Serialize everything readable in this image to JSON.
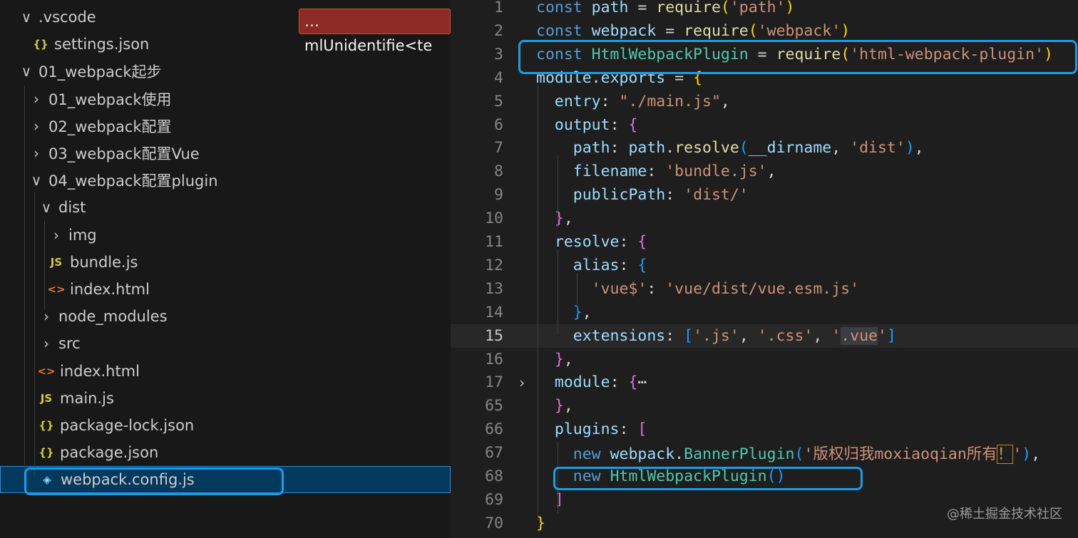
{
  "explorer": {
    "error_badge": "…mlUnidentifie<te",
    "items": [
      {
        "label": ".vscode",
        "chevron": "∨",
        "icon": "",
        "icon_name": "chevron-down-icon"
      },
      {
        "label": "settings.json",
        "chevron": "",
        "icon": "{}",
        "icon_name": "json-file-icon"
      },
      {
        "label": "01_webpack起步",
        "chevron": "∨",
        "icon": "",
        "icon_name": "chevron-down-icon"
      },
      {
        "label": "01_webpack使用",
        "chevron": "›",
        "icon": "",
        "icon_name": "chevron-right-icon"
      },
      {
        "label": "02_webpack配置",
        "chevron": "›",
        "icon": "",
        "icon_name": "chevron-right-icon"
      },
      {
        "label": "03_webpack配置Vue",
        "chevron": "›",
        "icon": "",
        "icon_name": "chevron-right-icon"
      },
      {
        "label": "04_webpack配置plugin",
        "chevron": "∨",
        "icon": "",
        "icon_name": "chevron-down-icon"
      },
      {
        "label": "dist",
        "chevron": "∨",
        "icon": "",
        "icon_name": "chevron-down-icon"
      },
      {
        "label": "img",
        "chevron": "›",
        "icon": "",
        "icon_name": "chevron-right-icon"
      },
      {
        "label": "bundle.js",
        "chevron": "",
        "icon": "JS",
        "icon_name": "js-file-icon"
      },
      {
        "label": "index.html",
        "chevron": "",
        "icon": "<>",
        "icon_name": "html-file-icon"
      },
      {
        "label": "node_modules",
        "chevron": "›",
        "icon": "",
        "icon_name": "chevron-right-icon"
      },
      {
        "label": "src",
        "chevron": "›",
        "icon": "",
        "icon_name": "chevron-right-icon"
      },
      {
        "label": "index.html",
        "chevron": "",
        "icon": "<>",
        "icon_name": "html-file-icon"
      },
      {
        "label": "main.js",
        "chevron": "",
        "icon": "JS",
        "icon_name": "js-file-icon"
      },
      {
        "label": "package-lock.json",
        "chevron": "",
        "icon": "{}",
        "icon_name": "json-file-icon"
      },
      {
        "label": "package.json",
        "chevron": "",
        "icon": "{}",
        "icon_name": "json-file-icon"
      },
      {
        "label": "webpack.config.js",
        "chevron": "",
        "icon": "◈",
        "icon_name": "webpack-file-icon",
        "selected": true
      }
    ]
  },
  "editor": {
    "lines": [
      {
        "n": "1",
        "tokens": [
          [
            "kw",
            "const "
          ],
          [
            "var",
            "path"
          ],
          [
            "pl",
            " = "
          ],
          [
            "fn",
            "require"
          ],
          [
            "p1",
            "("
          ],
          [
            "str",
            "'path'"
          ],
          [
            "p1",
            ")"
          ]
        ]
      },
      {
        "n": "2",
        "tokens": [
          [
            "kw",
            "const "
          ],
          [
            "var",
            "webpack"
          ],
          [
            "pl",
            " = "
          ],
          [
            "fn",
            "require"
          ],
          [
            "p1",
            "("
          ],
          [
            "str",
            "'webpack'"
          ],
          [
            "p1",
            ")"
          ]
        ]
      },
      {
        "n": "3",
        "tokens": [
          [
            "kw",
            "const "
          ],
          [
            "cls",
            "HtmlWebpackPlugin"
          ],
          [
            "pl",
            " = "
          ],
          [
            "fn",
            "require"
          ],
          [
            "p1",
            "("
          ],
          [
            "str",
            "'html-webpack-plugin'"
          ],
          [
            "p1",
            ")"
          ]
        ]
      },
      {
        "n": "4",
        "tokens": [
          [
            "var",
            "module"
          ],
          [
            "pl",
            "."
          ],
          [
            "var",
            "exports"
          ],
          [
            "pl",
            " = "
          ],
          [
            "p1",
            "{"
          ]
        ]
      },
      {
        "n": "5",
        "tokens": [
          [
            "pl",
            "  "
          ],
          [
            "var",
            "entry"
          ],
          [
            "pl",
            ": "
          ],
          [
            "str",
            "\"./main.js\""
          ],
          [
            "pl",
            ","
          ]
        ]
      },
      {
        "n": "6",
        "tokens": [
          [
            "pl",
            "  "
          ],
          [
            "var",
            "output"
          ],
          [
            "pl",
            ": "
          ],
          [
            "p2",
            "{"
          ]
        ]
      },
      {
        "n": "7",
        "tokens": [
          [
            "pl",
            "    "
          ],
          [
            "var",
            "path"
          ],
          [
            "pl",
            ": "
          ],
          [
            "var",
            "path"
          ],
          [
            "pl",
            "."
          ],
          [
            "fn",
            "resolve"
          ],
          [
            "p3",
            "("
          ],
          [
            "var",
            "__dirname"
          ],
          [
            "pl",
            ", "
          ],
          [
            "str",
            "'dist'"
          ],
          [
            "p3",
            ")"
          ],
          [
            "pl",
            ","
          ]
        ]
      },
      {
        "n": "8",
        "tokens": [
          [
            "pl",
            "    "
          ],
          [
            "var",
            "filename"
          ],
          [
            "pl",
            ": "
          ],
          [
            "str",
            "'bundle.js'"
          ],
          [
            "pl",
            ","
          ]
        ]
      },
      {
        "n": "9",
        "tokens": [
          [
            "pl",
            "    "
          ],
          [
            "var",
            "publicPath"
          ],
          [
            "pl",
            ": "
          ],
          [
            "str",
            "'dist/'"
          ]
        ]
      },
      {
        "n": "10",
        "tokens": [
          [
            "pl",
            "  "
          ],
          [
            "p2",
            "}"
          ],
          [
            "pl",
            ","
          ]
        ]
      },
      {
        "n": "11",
        "tokens": [
          [
            "pl",
            "  "
          ],
          [
            "var",
            "resolve"
          ],
          [
            "pl",
            ": "
          ],
          [
            "p2",
            "{"
          ]
        ]
      },
      {
        "n": "12",
        "tokens": [
          [
            "pl",
            "    "
          ],
          [
            "var",
            "alias"
          ],
          [
            "pl",
            ": "
          ],
          [
            "p3",
            "{"
          ]
        ]
      },
      {
        "n": "13",
        "tokens": [
          [
            "pl",
            "      "
          ],
          [
            "str",
            "'vue$'"
          ],
          [
            "pl",
            ": "
          ],
          [
            "str",
            "'vue/dist/vue.esm.js'"
          ]
        ]
      },
      {
        "n": "14",
        "tokens": [
          [
            "pl",
            "    "
          ],
          [
            "p3",
            "}"
          ],
          [
            "pl",
            ","
          ]
        ]
      },
      {
        "n": "15",
        "current": true,
        "tokens": [
          [
            "pl",
            "    "
          ],
          [
            "var",
            "extensions"
          ],
          [
            "pl",
            ": "
          ],
          [
            "p3",
            "["
          ],
          [
            "str",
            "'.js'"
          ],
          [
            "pl",
            ", "
          ],
          [
            "str",
            "'.css'"
          ],
          [
            "pl",
            ", "
          ],
          [
            "str",
            "'"
          ],
          [
            "str hl",
            ".vue"
          ],
          [
            "str",
            "'"
          ],
          [
            "p3",
            "]"
          ]
        ]
      },
      {
        "n": "16",
        "tokens": [
          [
            "pl",
            "  "
          ],
          [
            "p2",
            "}"
          ],
          [
            "pl",
            ","
          ]
        ]
      },
      {
        "n": "17",
        "fold": "›",
        "tokens": [
          [
            "pl",
            "  "
          ],
          [
            "var",
            "module"
          ],
          [
            "pl",
            ": "
          ],
          [
            "p2",
            "{"
          ],
          [
            "pl",
            "⋯"
          ]
        ]
      },
      {
        "n": "65",
        "tokens": [
          [
            "pl",
            "  "
          ],
          [
            "p2",
            "}"
          ],
          [
            "pl",
            ","
          ]
        ]
      },
      {
        "n": "66",
        "tokens": [
          [
            "pl",
            "  "
          ],
          [
            "var",
            "plugins"
          ],
          [
            "pl",
            ": "
          ],
          [
            "p2",
            "["
          ]
        ]
      },
      {
        "n": "67",
        "tokens": [
          [
            "pl",
            "    "
          ],
          [
            "kw",
            "new "
          ],
          [
            "var",
            "webpack"
          ],
          [
            "pl",
            "."
          ],
          [
            "cls",
            "BannerPlugin"
          ],
          [
            "p3",
            "("
          ],
          [
            "str",
            "'版权归我moxiaoqian所有"
          ],
          [
            "str warnbox",
            "！"
          ],
          [
            "str",
            "'"
          ],
          [
            "p3",
            ")"
          ],
          [
            "pl",
            ","
          ]
        ]
      },
      {
        "n": "68",
        "tokens": [
          [
            "pl",
            "    "
          ],
          [
            "kw",
            "new "
          ],
          [
            "cls",
            "HtmlWebpackPlugin"
          ],
          [
            "p3",
            "()"
          ]
        ]
      },
      {
        "n": "69",
        "tokens": [
          [
            "pl",
            "  "
          ],
          [
            "p2",
            "]"
          ]
        ]
      },
      {
        "n": "70",
        "tokens": [
          [
            "p1",
            "}"
          ]
        ]
      }
    ]
  },
  "watermark": "@稀土掘金技术社区",
  "colors": {
    "annotation": "#1a9ce8",
    "selection": "#04395e",
    "error": "#8e2a26"
  }
}
